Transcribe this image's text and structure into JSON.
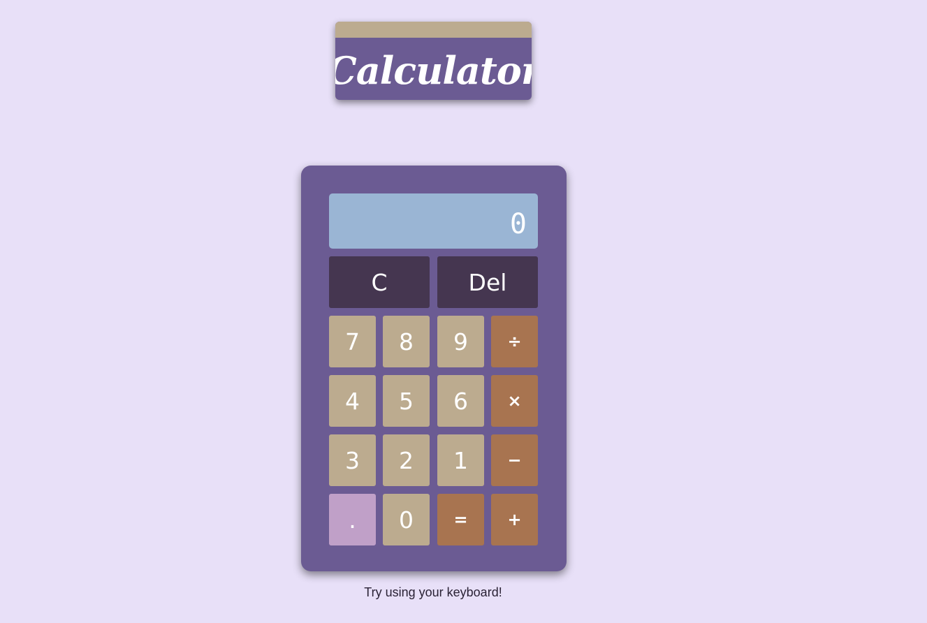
{
  "title": "Calculator",
  "display": {
    "value": "0"
  },
  "buttons": {
    "clear": "C",
    "delete": "Del",
    "seven": "7",
    "eight": "8",
    "nine": "9",
    "divide": "÷",
    "four": "4",
    "five": "5",
    "six": "6",
    "multiply": "×",
    "three": "3",
    "two": "2",
    "one": "1",
    "subtract": "−",
    "decimal": ".",
    "zero": "0",
    "equals": "=",
    "add": "+"
  },
  "hint": "Try using your keyboard!",
  "colors": {
    "background": "#e8e0f8",
    "body": "#6b5b93",
    "title_strip": "#bcab8f",
    "display": "#9ab5d4",
    "function_key": "#453650",
    "number_key": "#bcab8f",
    "operator_key": "#a87450",
    "decimal_key": "#c0a0c8"
  }
}
